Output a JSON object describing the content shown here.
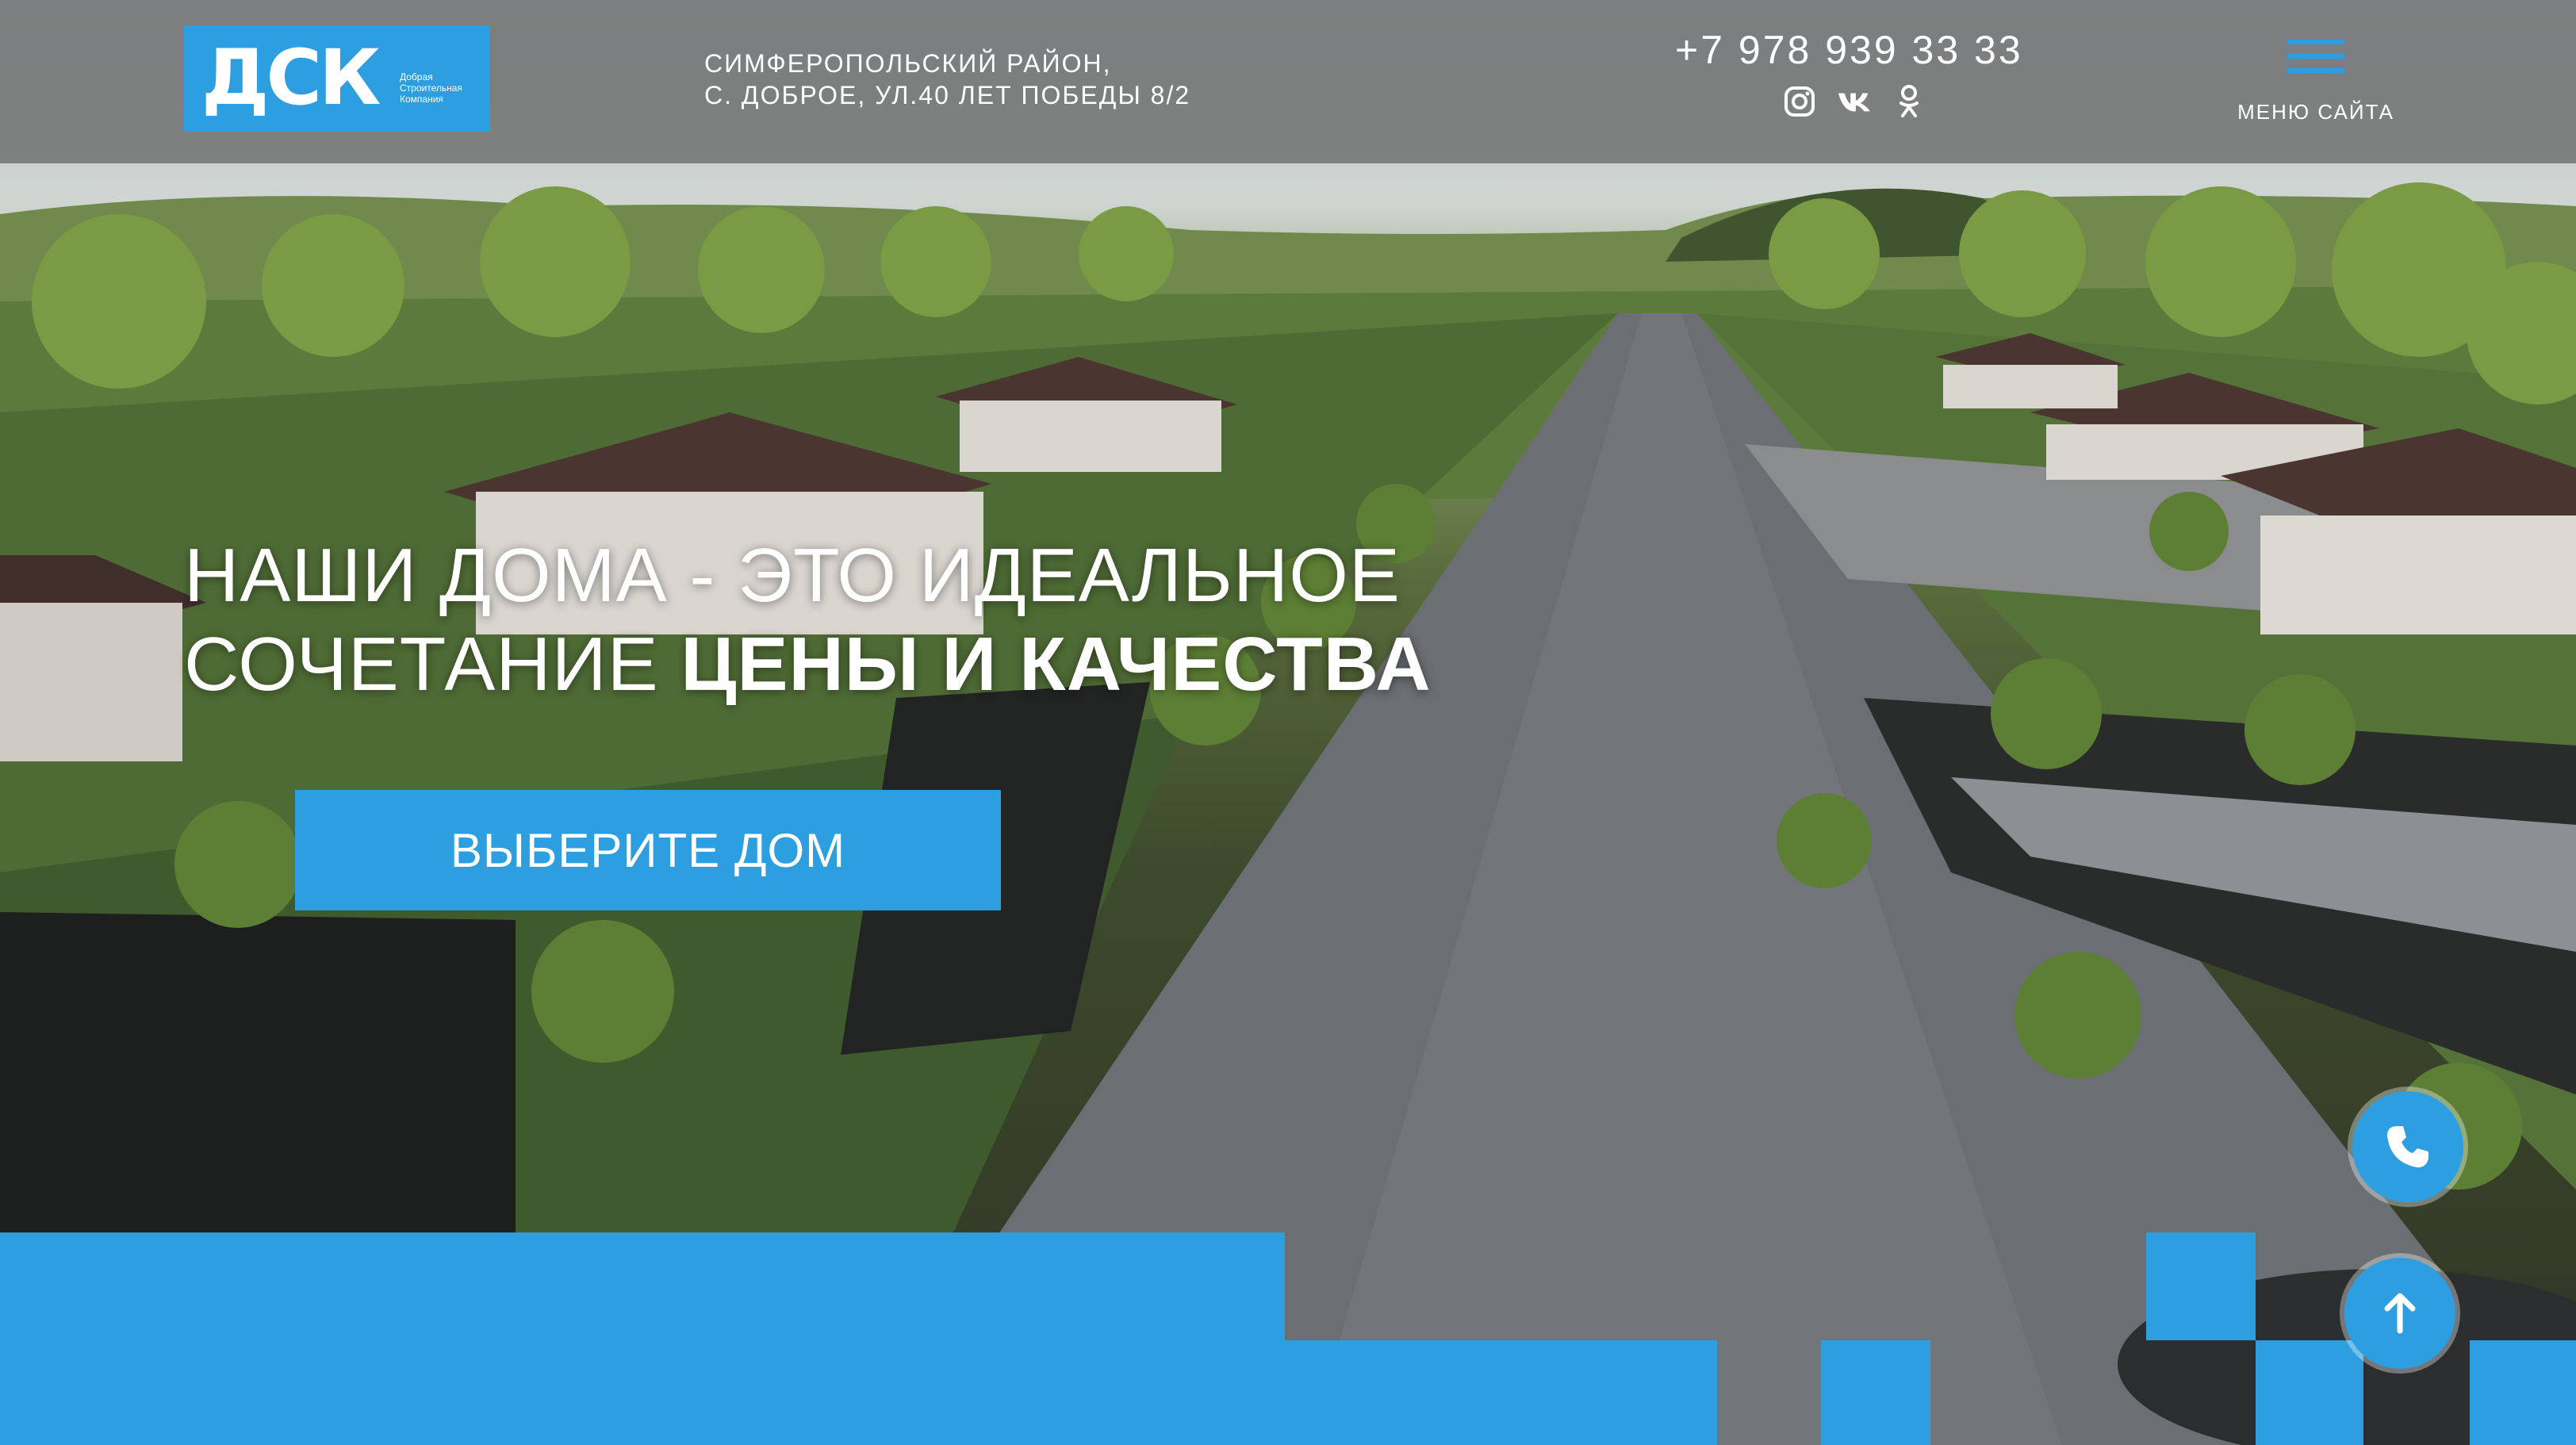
{
  "header": {
    "logo": {
      "mark": "ДСК",
      "subtitle_lines": [
        "Добрая",
        "Строительная",
        "Компания"
      ]
    },
    "address": {
      "line1": "СИМФЕРОПОЛЬСКИЙ РАЙОН,",
      "line2": "С. ДОБРОЕ, УЛ.40 ЛЕТ ПОБЕДЫ 8/2"
    },
    "phone": "+7 978 939 33 33",
    "socials": [
      {
        "name": "instagram-icon"
      },
      {
        "name": "vk-icon"
      },
      {
        "name": "odnoklassniki-icon"
      }
    ],
    "menu_label": "МЕНЮ САЙТА"
  },
  "hero": {
    "headline_line1": "НАШИ ДОМА - ЭТО ИДЕАЛЬНОЕ",
    "headline_line2_regular": "СОЧЕТАНИЕ ",
    "headline_line2_bold": "ЦЕНЫ И КАЧЕСТВА",
    "cta_label": "ВЫБЕРИТЕ ДОМ"
  },
  "floating": {
    "call_icon": "phone-icon",
    "top_icon": "arrow-up-icon"
  },
  "colors": {
    "accent": "#2d9fe0",
    "header_bg": "#6e6e6e",
    "text": "#ffffff"
  }
}
